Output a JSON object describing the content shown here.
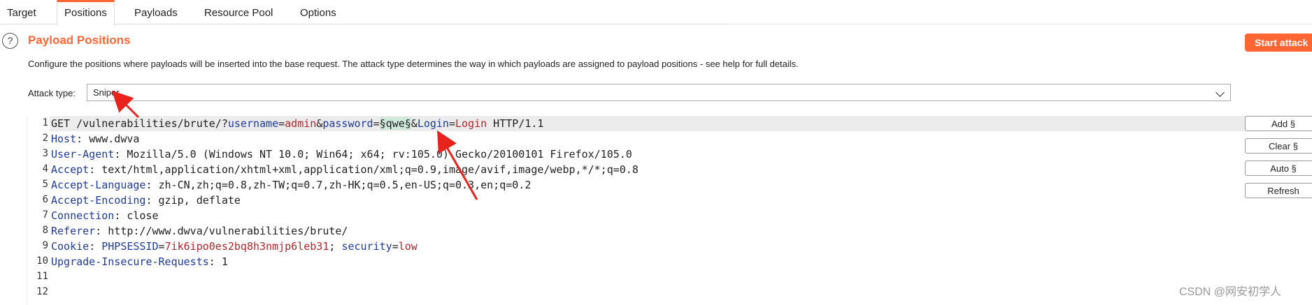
{
  "tabs": [
    {
      "label": "Target"
    },
    {
      "label": "Positions",
      "active": true
    },
    {
      "label": "Payloads"
    },
    {
      "label": "Resource Pool"
    },
    {
      "label": "Options"
    }
  ],
  "header": {
    "help_icon": "question-circle-icon",
    "title": "Payload Positions",
    "description": "Configure the positions where payloads will be inserted into the base request. The attack type determines the way in which payloads are assigned to payload positions - see help for full details.",
    "start_attack_label": "Start attack"
  },
  "attack_type": {
    "label": "Attack type:",
    "value": "Sniper"
  },
  "buttons": {
    "add": "Add §",
    "clear": "Clear §",
    "auto": "Auto §",
    "refresh": "Refresh"
  },
  "request": {
    "line_numbers": [
      "1",
      "2",
      "3",
      "4",
      "5",
      "6",
      "7",
      "8",
      "9",
      "10",
      "11",
      "12"
    ],
    "request_line": {
      "method_path": "GET /vulnerabilities/brute/?",
      "p1_name": "username",
      "p1_value": "admin",
      "p2_name": "password",
      "marked_payload": "§qwe§",
      "p3_name": "Login",
      "p3_value": "Login",
      "protocol": " HTTP/1.1"
    },
    "headers": [
      {
        "name": "Host",
        "value": "www.dwva"
      },
      {
        "name": "User-Agent",
        "value": "Mozilla/5.0 (Windows NT 10.0; Win64; x64; rv:105.0) Gecko/20100101 Firefox/105.0"
      },
      {
        "name": "Accept",
        "value": "text/html,application/xhtml+xml,application/xml;q=0.9,image/avif,image/webp,*/*;q=0.8"
      },
      {
        "name": "Accept-Language",
        "value": "zh-CN,zh;q=0.8,zh-TW;q=0.7,zh-HK;q=0.5,en-US;q=0.3,en;q=0.2"
      },
      {
        "name": "Accept-Encoding",
        "value": "gzip, deflate"
      },
      {
        "name": "Connection",
        "value": "close"
      },
      {
        "name": "Referer",
        "value": "http://www.dwva/vulnerabilities/brute/"
      }
    ],
    "cookie": {
      "name": "Cookie",
      "c1_name": "PHPSESSID",
      "c1_value": "7ik6ipo0es2bq8h3nmjp6leb31",
      "c2_name": "security",
      "c2_value": "low"
    },
    "upgrade": {
      "name": "Upgrade-Insecure-Requests",
      "value": "1"
    }
  },
  "watermark": "CSDN @网安初学人",
  "colors": {
    "accent": "#ff6633",
    "header_name": "#1f3b9c",
    "param_value": "#b3262b",
    "payload_mark_bg": "#cfeadd",
    "annotation_arrow": "#e8231d"
  }
}
